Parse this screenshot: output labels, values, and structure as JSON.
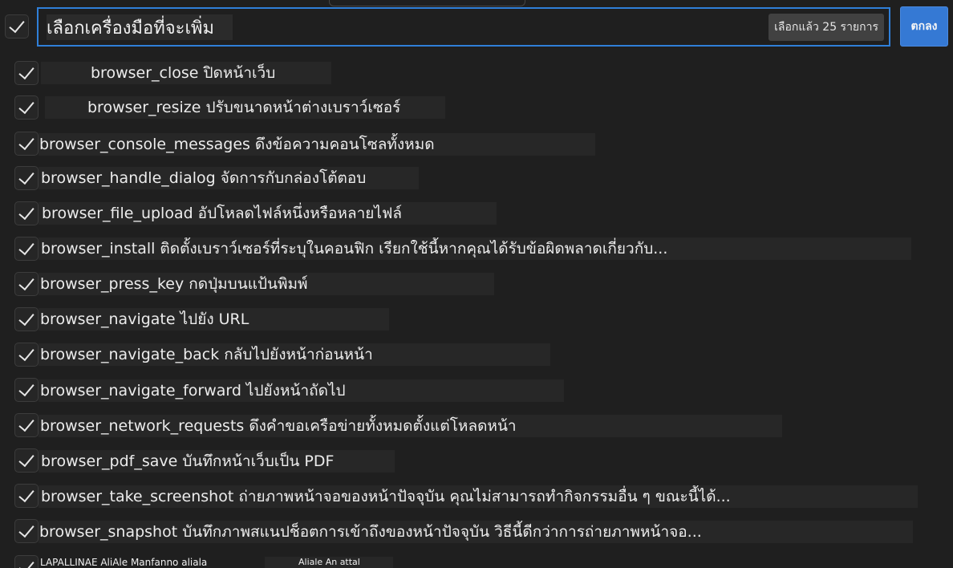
{
  "search": {
    "value": "เลือกเครื่องมือที่จะเพิ่ม",
    "selected_count": "เลือกแล้ว 25 รายการ"
  },
  "ok_button": "ตกลง",
  "items": [
    {
      "name": "browser_close",
      "desc": "ปิดหน้าเว็บ"
    },
    {
      "name": "browser_resize",
      "desc": "ปรับขนาดหน้าต่างเบราว์เซอร์"
    },
    {
      "name": "browser_console_messages",
      "desc": "ดึงข้อความคอนโซลทั้งหมด"
    },
    {
      "name": "browser_handle_dialog",
      "desc": "จัดการกับกล่องโต้ตอบ"
    },
    {
      "name": "browser_file_upload",
      "desc": "อัปโหลดไฟล์หนึ่งหรือหลายไฟล์"
    },
    {
      "name": "browser_install",
      "desc": "ติดตั้งเบราว์เซอร์ที่ระบุในคอนฟิก เรียกใช้นี้หากคุณได้รับข้อผิดพลาดเกี่ยวกับ..."
    },
    {
      "name": "browser_press_key",
      "desc": "กดปุ่มบนแป้นพิมพ์"
    },
    {
      "name": "browser_navigate",
      "desc": "ไปยัง URL"
    },
    {
      "name": "browser_navigate_back",
      "desc": "กลับไปยังหน้าก่อนหน้า"
    },
    {
      "name": "browser_navigate_forward",
      "desc": "ไปยังหน้าถัดไป"
    },
    {
      "name": "browser_network_requests",
      "desc": "ดึงคำขอเครือข่ายทั้งหมดตั้งแต่โหลดหน้า"
    },
    {
      "name": "browser_pdf_save",
      "desc": "บันทึกหน้าเว็บเป็น PDF"
    },
    {
      "name": "browser_take_screenshot",
      "desc": "ถ่ายภาพหน้าจอของหน้าปัจจุบัน คุณไม่สามารถทำกิจกรรมอื่น ๆ ขณะนี้ได้..."
    },
    {
      "name": "browser_snapshot",
      "desc": "บันทึกภาพสแนปช็อตการเข้าถึงของหน้าปัจจุบัน วิธีนี้ดีกว่าการถ่ายภาพหน้าจอ..."
    }
  ],
  "partial_row": {
    "text": "LAPALLINAE AliAle Manfanno aliala",
    "text2": "Aliale An attal"
  }
}
